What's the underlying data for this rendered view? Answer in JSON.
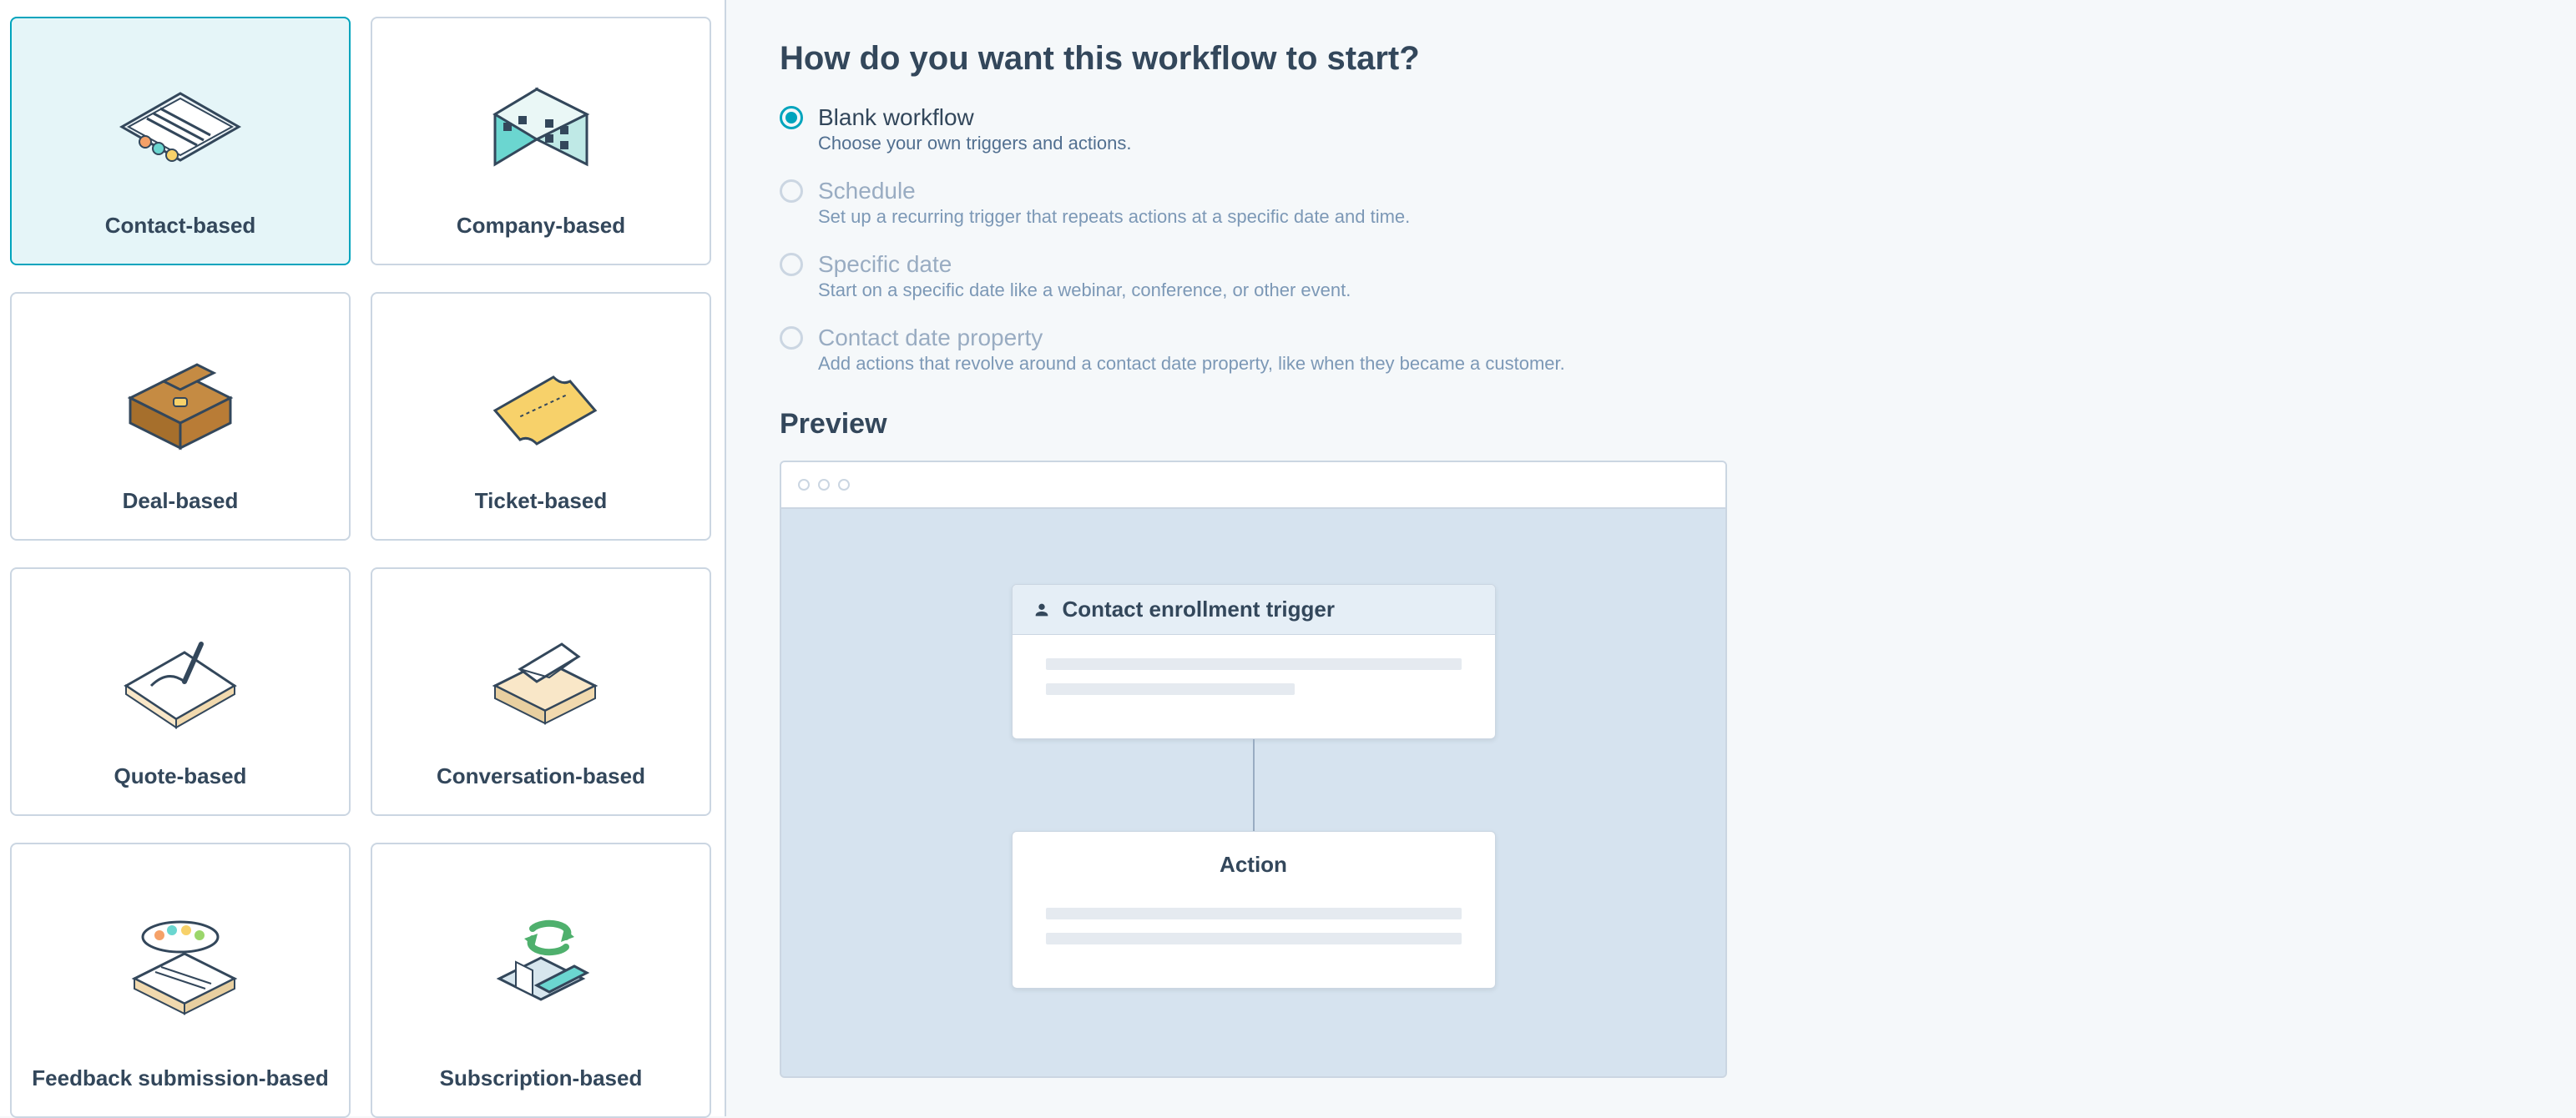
{
  "types": [
    {
      "key": "contact",
      "label": "Contact-based",
      "selected": true
    },
    {
      "key": "company",
      "label": "Company-based",
      "selected": false
    },
    {
      "key": "deal",
      "label": "Deal-based",
      "selected": false
    },
    {
      "key": "ticket",
      "label": "Ticket-based",
      "selected": false
    },
    {
      "key": "quote",
      "label": "Quote-based",
      "selected": false
    },
    {
      "key": "conversation",
      "label": "Conversation-based",
      "selected": false
    },
    {
      "key": "feedback",
      "label": "Feedback submission-based",
      "selected": false
    },
    {
      "key": "subscription",
      "label": "Subscription-based",
      "selected": false
    }
  ],
  "heading": "How do you want this workflow to start?",
  "options": [
    {
      "key": "blank",
      "title": "Blank workflow",
      "desc": "Choose your own triggers and actions.",
      "selected": true,
      "disabled": false
    },
    {
      "key": "schedule",
      "title": "Schedule",
      "desc": "Set up a recurring trigger that repeats actions at a specific date and time.",
      "selected": false,
      "disabled": true
    },
    {
      "key": "specific",
      "title": "Specific date",
      "desc": "Start on a specific date like a webinar, conference, or other event.",
      "selected": false,
      "disabled": true
    },
    {
      "key": "property",
      "title": "Contact date property",
      "desc": "Add actions that revolve around a contact date property, like when they became a customer.",
      "selected": false,
      "disabled": true
    }
  ],
  "preview_heading": "Preview",
  "preview": {
    "trigger_title": "Contact enrollment trigger",
    "action_title": "Action"
  }
}
